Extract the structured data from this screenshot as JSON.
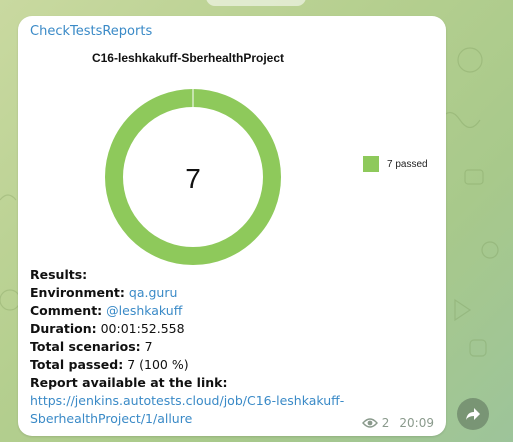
{
  "message": {
    "sender": "CheckTestsReports",
    "views": "2",
    "time": "20:09",
    "lines": [
      {
        "label": "Results:",
        "value": ""
      },
      {
        "label": "Environment:",
        "value": "qa.guru"
      },
      {
        "label": "Comment:",
        "value": "@leshkakuff"
      },
      {
        "label": "Duration:",
        "value": "00:01:52.558"
      },
      {
        "label": "Total scenarios:",
        "value": "7"
      },
      {
        "label": "Total passed:",
        "value": "7 (100 %)"
      },
      {
        "label": "Report available at the link:",
        "value": ""
      }
    ],
    "link_line1": "https://jenkins.autotests.cloud/job/C16-leshkakuff-",
    "link_line2": "SberhealthProject/1/allure"
  },
  "chart_data": {
    "type": "pie",
    "title": "C16-leshkakuff-SberhealthProject",
    "center_label": "7",
    "slices": [
      {
        "label": "7 passed",
        "value": 7,
        "color": "#8ec95b"
      }
    ],
    "legend": [
      "7 passed"
    ],
    "legend_position": "right"
  },
  "colors": {
    "accent": "#3a8ac7",
    "passed": "#8ec95b"
  }
}
